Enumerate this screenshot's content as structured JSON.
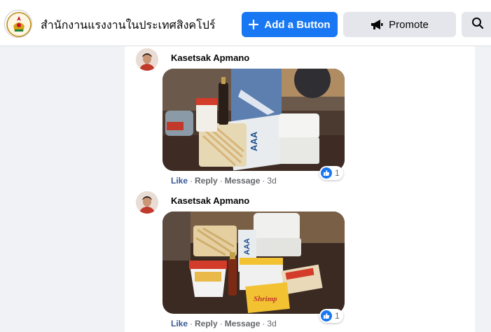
{
  "header": {
    "page_name": "สำนักงานแรงงานในประเทศสิงคโปร์",
    "add_button_label": "Add a Button",
    "promote_label": "Promote"
  },
  "colors": {
    "accent": "#1877f2",
    "link": "#385898",
    "secondary_button": "#e4e6eb"
  },
  "comments": [
    {
      "author": "Kasetsak Apmano",
      "actions": {
        "like": "Like",
        "reply": "Reply",
        "message": "Message",
        "time": "3d"
      },
      "reaction_count": "1"
    },
    {
      "author": "Kasetsak Apmano",
      "actions": {
        "like": "Like",
        "reply": "Reply",
        "message": "Message",
        "time": "3d"
      },
      "reaction_count": "1"
    }
  ]
}
